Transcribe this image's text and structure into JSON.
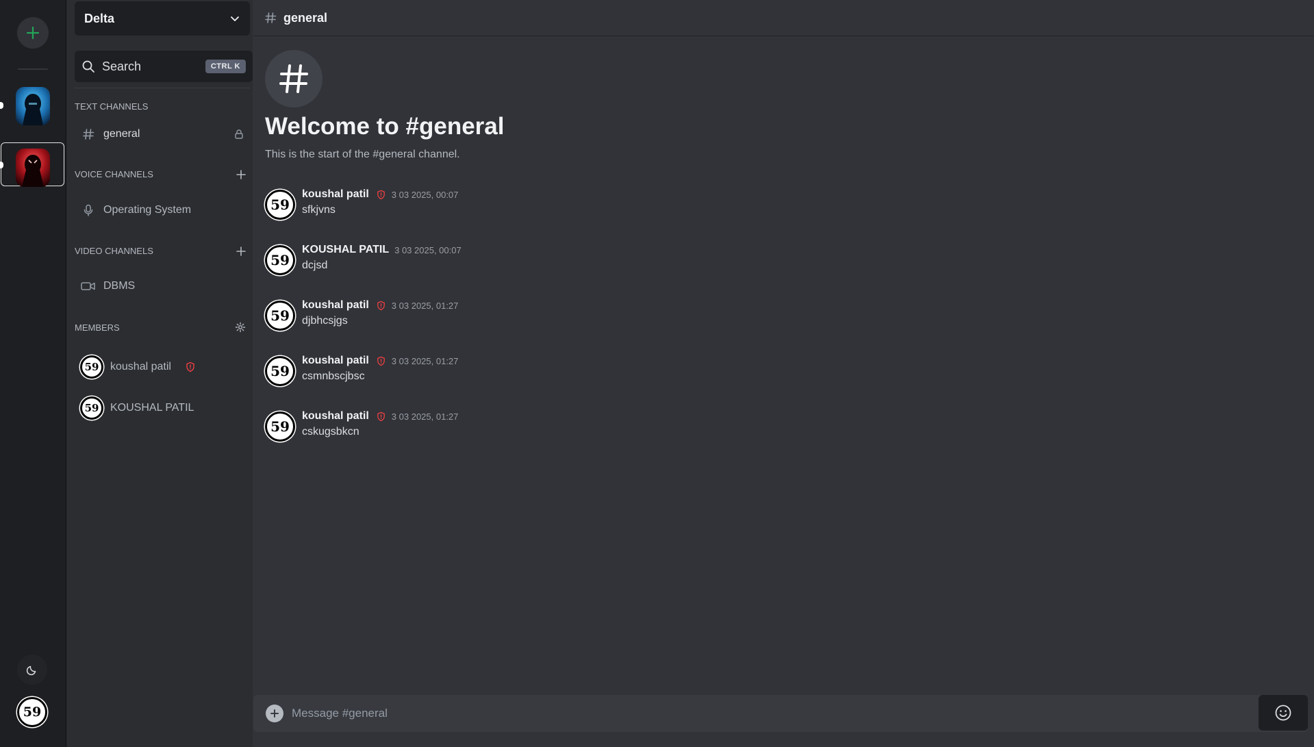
{
  "server": {
    "name": "Delta"
  },
  "search": {
    "label": "Search",
    "shortcut": "CTRL K"
  },
  "sections": {
    "text": "TEXT CHANNELS",
    "voice": "VOICE CHANNELS",
    "video": "VIDEO CHANNELS",
    "members": "MEMBERS"
  },
  "channels": {
    "text": [
      {
        "label": "general",
        "icon": "hash-icon",
        "locked": true
      }
    ],
    "voice": [
      {
        "label": "Operating System",
        "icon": "mic-icon"
      }
    ],
    "video": [
      {
        "label": "DBMS",
        "icon": "video-icon"
      }
    ]
  },
  "members": [
    {
      "name": "koushal patil",
      "avatar": "59",
      "role_icon": "shield-alert-icon"
    },
    {
      "name": "KOUSHAL PATIL",
      "avatar": "59"
    }
  ],
  "current_channel": {
    "name": "general"
  },
  "welcome": {
    "title": "Welcome to #general",
    "subtitle": "This is the start of the #general channel."
  },
  "messages": [
    {
      "author": "koushal patil",
      "admin": true,
      "time": "3 03 2025, 00:07",
      "text": "sfkjvns",
      "avatar": "59"
    },
    {
      "author": "KOUSHAL PATIL",
      "admin": false,
      "time": "3 03 2025, 00:07",
      "text": "dcjsd",
      "avatar": "59"
    },
    {
      "author": "koushal patil",
      "admin": true,
      "time": "3 03 2025, 01:27",
      "text": "djbhcsjgs",
      "avatar": "59"
    },
    {
      "author": "koushal patil",
      "admin": true,
      "time": "3 03 2025, 01:27",
      "text": "csmnbscjbsc",
      "avatar": "59"
    },
    {
      "author": "koushal patil",
      "admin": true,
      "time": "3 03 2025, 01:27",
      "text": "cskugsbkcn",
      "avatar": "59"
    }
  ],
  "composer": {
    "placeholder": "Message #general"
  },
  "user": {
    "avatar": "59"
  },
  "colors": {
    "accent_green": "#23a559",
    "admin_red": "#f23f43",
    "background": "#313338",
    "sidebar": "#2b2d31",
    "rail": "#1e1f22"
  }
}
